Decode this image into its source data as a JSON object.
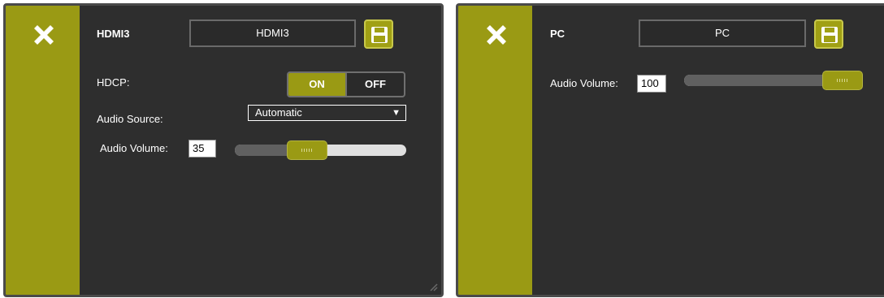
{
  "left_panel": {
    "input_name": "HDMI3",
    "name_field_value": "HDMI3",
    "hdcp_label": "HDCP:",
    "hdcp_on": "ON",
    "hdcp_off": "OFF",
    "audio_source_label": "Audio Source:",
    "audio_source_value": "Automatic",
    "audio_volume_label": "Audio Volume:",
    "audio_volume_value": "35",
    "audio_volume_level": 0.35
  },
  "right_panel": {
    "input_name": "PC",
    "name_field_value": "PC",
    "audio_volume_label": "Audio Volume:",
    "audio_volume_value": "100",
    "audio_volume_level": 1.0
  },
  "colors": {
    "accent": "#9a9a14",
    "panel_bg": "#2e2e2e"
  },
  "icons": [
    "close-icon",
    "save-icon",
    "chevron-down-icon"
  ]
}
